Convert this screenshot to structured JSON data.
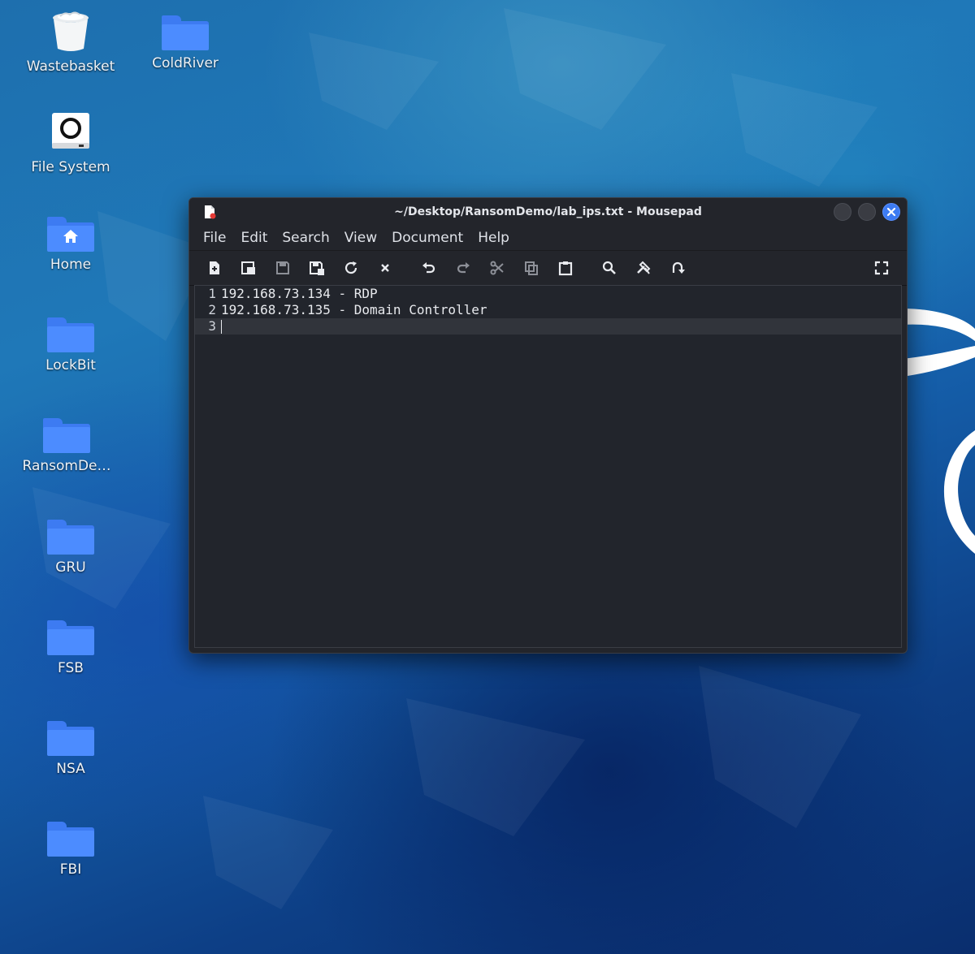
{
  "desktop": {
    "icons": [
      {
        "label": "Wastebasket",
        "icon": "trash-icon"
      },
      {
        "label": "ColdRiver",
        "icon": "folder-icon"
      },
      {
        "label": "File System",
        "icon": "drive-icon"
      },
      {
        "label": "Home",
        "icon": "home-folder-icon"
      },
      {
        "label": "LockBit",
        "icon": "folder-icon"
      },
      {
        "label": "RansomDe…",
        "icon": "folder-icon"
      },
      {
        "label": "GRU",
        "icon": "folder-icon"
      },
      {
        "label": "FSB",
        "icon": "folder-icon"
      },
      {
        "label": "NSA",
        "icon": "folder-icon"
      },
      {
        "label": "FBI",
        "icon": "folder-icon"
      }
    ]
  },
  "window": {
    "title": "~/Desktop/RansomDemo/lab_ips.txt - Mousepad",
    "menu": [
      "File",
      "Edit",
      "Search",
      "View",
      "Document",
      "Help"
    ],
    "toolbar": [
      "new-document-icon",
      "new-window-icon",
      "save-icon",
      "save-as-icon",
      "reload-icon",
      "close-document-icon",
      "undo-icon",
      "redo-icon",
      "cut-icon",
      "copy-icon",
      "paste-icon",
      "find-icon",
      "find-replace-icon",
      "go-to-line-icon",
      "fullscreen-icon"
    ],
    "editor": {
      "lines": [
        {
          "num": "1",
          "text": "192.168.73.134 - RDP"
        },
        {
          "num": "2",
          "text": "192.168.73.135 - Domain Controller"
        },
        {
          "num": "3",
          "text": ""
        }
      ],
      "current_line": 3
    }
  },
  "colors": {
    "accent": "#3d7bf2",
    "window_bg": "#23252b",
    "editor_bg": "#22252c"
  }
}
